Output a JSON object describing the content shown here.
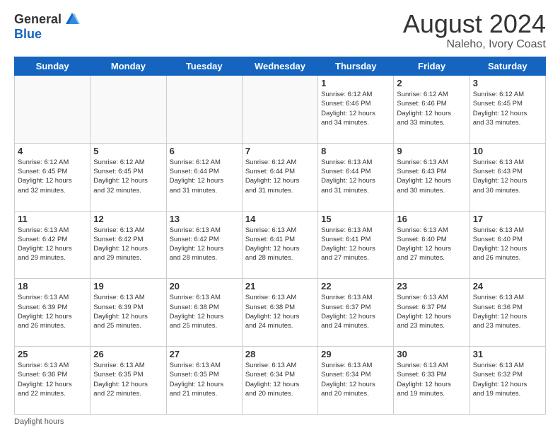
{
  "logo": {
    "general": "General",
    "blue": "Blue"
  },
  "header": {
    "month_year": "August 2024",
    "location": "Naleho, Ivory Coast"
  },
  "days_of_week": [
    "Sunday",
    "Monday",
    "Tuesday",
    "Wednesday",
    "Thursday",
    "Friday",
    "Saturday"
  ],
  "weeks": [
    [
      {
        "day": "",
        "info": ""
      },
      {
        "day": "",
        "info": ""
      },
      {
        "day": "",
        "info": ""
      },
      {
        "day": "",
        "info": ""
      },
      {
        "day": "1",
        "info": "Sunrise: 6:12 AM\nSunset: 6:46 PM\nDaylight: 12 hours\nand 34 minutes."
      },
      {
        "day": "2",
        "info": "Sunrise: 6:12 AM\nSunset: 6:46 PM\nDaylight: 12 hours\nand 33 minutes."
      },
      {
        "day": "3",
        "info": "Sunrise: 6:12 AM\nSunset: 6:45 PM\nDaylight: 12 hours\nand 33 minutes."
      }
    ],
    [
      {
        "day": "4",
        "info": "Sunrise: 6:12 AM\nSunset: 6:45 PM\nDaylight: 12 hours\nand 32 minutes."
      },
      {
        "day": "5",
        "info": "Sunrise: 6:12 AM\nSunset: 6:45 PM\nDaylight: 12 hours\nand 32 minutes."
      },
      {
        "day": "6",
        "info": "Sunrise: 6:12 AM\nSunset: 6:44 PM\nDaylight: 12 hours\nand 31 minutes."
      },
      {
        "day": "7",
        "info": "Sunrise: 6:12 AM\nSunset: 6:44 PM\nDaylight: 12 hours\nand 31 minutes."
      },
      {
        "day": "8",
        "info": "Sunrise: 6:13 AM\nSunset: 6:44 PM\nDaylight: 12 hours\nand 31 minutes."
      },
      {
        "day": "9",
        "info": "Sunrise: 6:13 AM\nSunset: 6:43 PM\nDaylight: 12 hours\nand 30 minutes."
      },
      {
        "day": "10",
        "info": "Sunrise: 6:13 AM\nSunset: 6:43 PM\nDaylight: 12 hours\nand 30 minutes."
      }
    ],
    [
      {
        "day": "11",
        "info": "Sunrise: 6:13 AM\nSunset: 6:42 PM\nDaylight: 12 hours\nand 29 minutes."
      },
      {
        "day": "12",
        "info": "Sunrise: 6:13 AM\nSunset: 6:42 PM\nDaylight: 12 hours\nand 29 minutes."
      },
      {
        "day": "13",
        "info": "Sunrise: 6:13 AM\nSunset: 6:42 PM\nDaylight: 12 hours\nand 28 minutes."
      },
      {
        "day": "14",
        "info": "Sunrise: 6:13 AM\nSunset: 6:41 PM\nDaylight: 12 hours\nand 28 minutes."
      },
      {
        "day": "15",
        "info": "Sunrise: 6:13 AM\nSunset: 6:41 PM\nDaylight: 12 hours\nand 27 minutes."
      },
      {
        "day": "16",
        "info": "Sunrise: 6:13 AM\nSunset: 6:40 PM\nDaylight: 12 hours\nand 27 minutes."
      },
      {
        "day": "17",
        "info": "Sunrise: 6:13 AM\nSunset: 6:40 PM\nDaylight: 12 hours\nand 26 minutes."
      }
    ],
    [
      {
        "day": "18",
        "info": "Sunrise: 6:13 AM\nSunset: 6:39 PM\nDaylight: 12 hours\nand 26 minutes."
      },
      {
        "day": "19",
        "info": "Sunrise: 6:13 AM\nSunset: 6:39 PM\nDaylight: 12 hours\nand 25 minutes."
      },
      {
        "day": "20",
        "info": "Sunrise: 6:13 AM\nSunset: 6:38 PM\nDaylight: 12 hours\nand 25 minutes."
      },
      {
        "day": "21",
        "info": "Sunrise: 6:13 AM\nSunset: 6:38 PM\nDaylight: 12 hours\nand 24 minutes."
      },
      {
        "day": "22",
        "info": "Sunrise: 6:13 AM\nSunset: 6:37 PM\nDaylight: 12 hours\nand 24 minutes."
      },
      {
        "day": "23",
        "info": "Sunrise: 6:13 AM\nSunset: 6:37 PM\nDaylight: 12 hours\nand 23 minutes."
      },
      {
        "day": "24",
        "info": "Sunrise: 6:13 AM\nSunset: 6:36 PM\nDaylight: 12 hours\nand 23 minutes."
      }
    ],
    [
      {
        "day": "25",
        "info": "Sunrise: 6:13 AM\nSunset: 6:36 PM\nDaylight: 12 hours\nand 22 minutes."
      },
      {
        "day": "26",
        "info": "Sunrise: 6:13 AM\nSunset: 6:35 PM\nDaylight: 12 hours\nand 22 minutes."
      },
      {
        "day": "27",
        "info": "Sunrise: 6:13 AM\nSunset: 6:35 PM\nDaylight: 12 hours\nand 21 minutes."
      },
      {
        "day": "28",
        "info": "Sunrise: 6:13 AM\nSunset: 6:34 PM\nDaylight: 12 hours\nand 20 minutes."
      },
      {
        "day": "29",
        "info": "Sunrise: 6:13 AM\nSunset: 6:34 PM\nDaylight: 12 hours\nand 20 minutes."
      },
      {
        "day": "30",
        "info": "Sunrise: 6:13 AM\nSunset: 6:33 PM\nDaylight: 12 hours\nand 19 minutes."
      },
      {
        "day": "31",
        "info": "Sunrise: 6:13 AM\nSunset: 6:32 PM\nDaylight: 12 hours\nand 19 minutes."
      }
    ]
  ],
  "footer": {
    "label": "Daylight hours"
  }
}
